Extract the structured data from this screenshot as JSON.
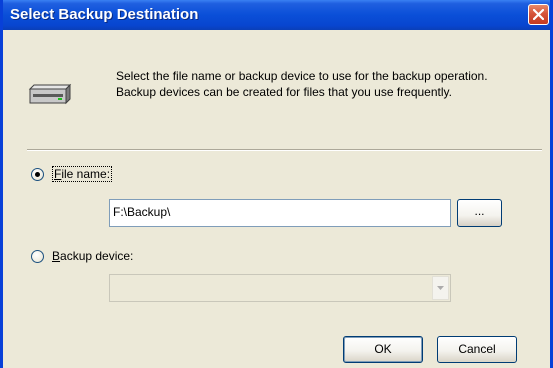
{
  "window": {
    "title": "Select Backup Destination"
  },
  "intro": {
    "text": "Select the file name or backup device to use for the backup operation.  Backup devices can be created for files that you use frequently."
  },
  "options": {
    "file_name": {
      "label_mnemonic": "F",
      "label_rest": "ile name:",
      "selected": true
    },
    "backup_device": {
      "label_mnemonic": "B",
      "label_rest": "ackup device:",
      "selected": false
    }
  },
  "file_path": {
    "value": "F:\\Backup\\"
  },
  "browse_button": {
    "label": "..."
  },
  "backup_device_select": {
    "value": "",
    "enabled": false
  },
  "buttons": {
    "ok": "OK",
    "cancel": "Cancel"
  },
  "icons": {
    "close": "close-icon",
    "drive": "tape-drive-icon",
    "dropdown": "chevron-down-icon"
  },
  "colors": {
    "titlebar": "#0a4fd8",
    "close_button": "#d6543a",
    "dialog_background": "#ece9d8"
  }
}
